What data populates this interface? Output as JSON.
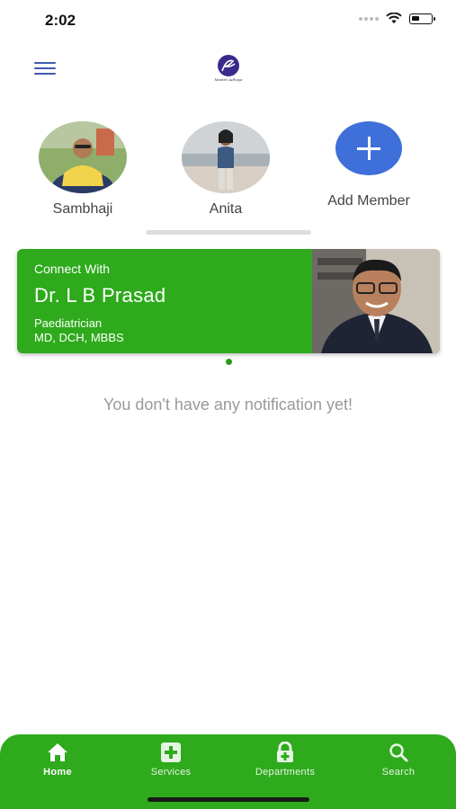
{
  "status_bar": {
    "time": "2:02"
  },
  "header": {
    "logo_text": "Mastiri Adhaya"
  },
  "members": [
    {
      "name": "Sambhaji"
    },
    {
      "name": "Anita"
    },
    {
      "name": "Add Member"
    }
  ],
  "banner": {
    "connect_with": "Connect With",
    "doctor_name": "Dr. L B Prasad",
    "speciality": "Paediatrician",
    "degrees": "MD, DCH, MBBS"
  },
  "empty_message": "You don't have any notification yet!",
  "bottom_nav": [
    {
      "label": "Home",
      "icon": "home-icon",
      "active": true
    },
    {
      "label": "Services",
      "icon": "medical-plus-icon"
    },
    {
      "label": "Departments",
      "icon": "lock-plus-icon"
    },
    {
      "label": "Search",
      "icon": "search-icon"
    }
  ],
  "colors": {
    "brand_green": "#2eaa1c",
    "accent_blue": "#3f6fd8"
  }
}
